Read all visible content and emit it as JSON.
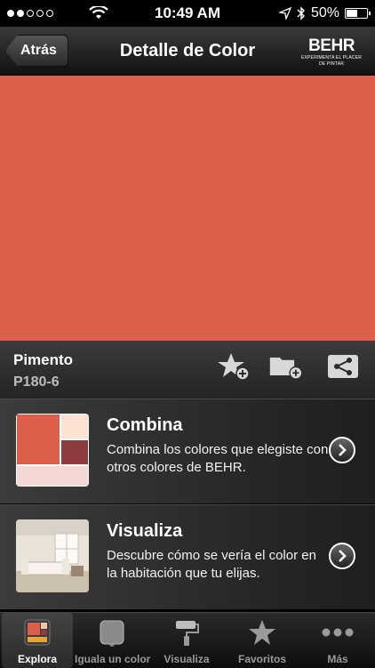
{
  "status_bar": {
    "time": "10:49 AM",
    "battery_text": "50%",
    "battery_level": 0.5
  },
  "nav": {
    "back_label": "Atrás",
    "title": "Detalle de Color",
    "logo_text": "BEHR",
    "logo_tagline": "EXPERIMENTA EL PLACER DE PINTAR"
  },
  "color": {
    "name": "Pimento",
    "code": "P180-6",
    "hex": "#dc5f4b"
  },
  "cards": [
    {
      "title": "Combina",
      "description": "Combina los colores que elegiste con otros colores de BEHR.",
      "palette": [
        "#dc5f4b",
        "#fbe2d2",
        "#8e3b40",
        "#f5d7d3"
      ]
    },
    {
      "title": "Visualiza",
      "description": "Descubre cómo se vería el color en la habitación que tu elijas."
    }
  ],
  "tabs": [
    {
      "label": "Explora",
      "icon": "palette-icon",
      "active": true
    },
    {
      "label": "Iguala un color",
      "icon": "chip-icon",
      "active": false
    },
    {
      "label": "Visualiza",
      "icon": "paint-roller-icon",
      "active": false
    },
    {
      "label": "Favoritos",
      "icon": "star-icon",
      "active": false
    },
    {
      "label": "Más",
      "icon": "more-icon",
      "active": false
    }
  ]
}
